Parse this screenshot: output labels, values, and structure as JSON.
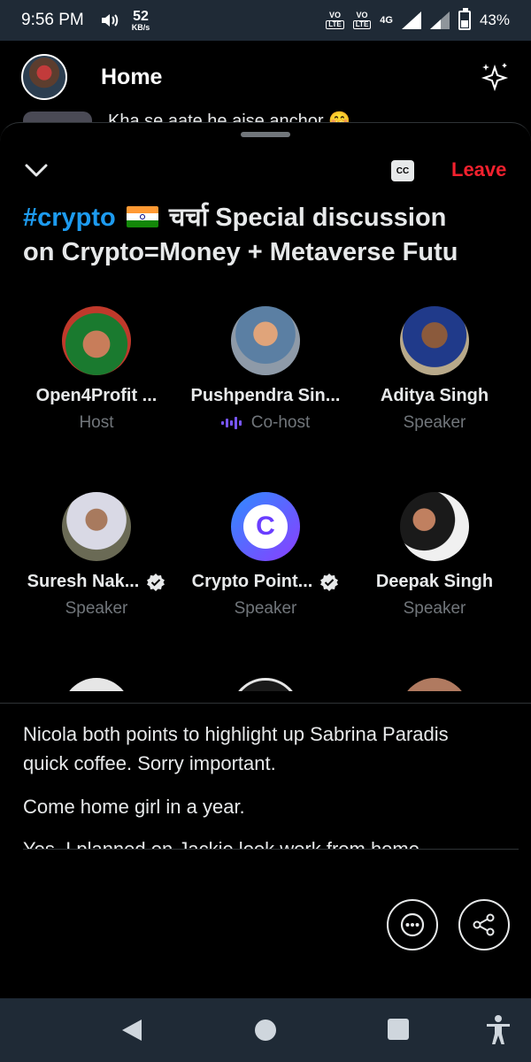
{
  "status_bar": {
    "time": "9:56 PM",
    "speed_value": "52",
    "speed_unit": "KB/s",
    "sim1_label": "VO",
    "sim1_sub": "LTE",
    "sim2_label": "VO",
    "sim2_sub": "LTE",
    "network": "4G",
    "battery": "43%"
  },
  "header": {
    "title": "Home"
  },
  "feed_peek": {
    "text": "Kha se aate he aise anchor 🤭"
  },
  "space": {
    "cc_label": "CC",
    "leave_label": "Leave",
    "title_hashtag": "#crypto",
    "title_rest_line1": " चर्चा Special discussion",
    "title_line2": "on Crypto=Money + Metaverse Futu"
  },
  "speakers": [
    {
      "name": "Open4Profit ...",
      "role": "Host",
      "verified": false,
      "speaking": false
    },
    {
      "name": "Pushpendra Sin...",
      "role": "Co-host",
      "verified": false,
      "speaking": true
    },
    {
      "name": "Aditya Singh",
      "role": "Speaker",
      "verified": false,
      "speaking": false
    },
    {
      "name": "Suresh Nak...",
      "role": "Speaker",
      "verified": true,
      "speaking": false
    },
    {
      "name": "Crypto Point...",
      "role": "Speaker",
      "verified": true,
      "speaking": false
    },
    {
      "name": "Deepak Singh",
      "role": "Speaker",
      "verified": false,
      "speaking": false
    }
  ],
  "captions": [
    "Nicola both points to highlight up Sabrina Paradis quick coffee. Sorry important.",
    "Come home girl in a year.",
    "Yes, I planned on Jackie look work from home."
  ],
  "colors": {
    "accent": "#1d9bf0",
    "leave": "#f4212e",
    "wave": "#7856ff",
    "verified_badge": "#e7e9ea"
  },
  "icons": {
    "more": "ellipsis-circle-icon",
    "share": "share-icon",
    "sparkle": "sparkle-icon"
  }
}
